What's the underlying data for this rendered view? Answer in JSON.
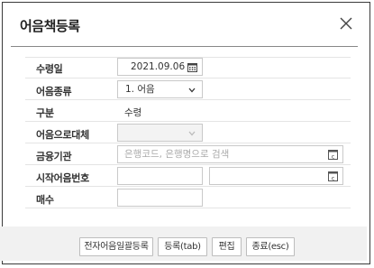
{
  "dialog": {
    "title": "어음책등록"
  },
  "form": {
    "receipt_date": {
      "label": "수령일",
      "value": "2021.09.06"
    },
    "bill_type": {
      "label": "어음종류",
      "value": "1. 어음"
    },
    "category": {
      "label": "구분",
      "value": "수령"
    },
    "bill_substitute": {
      "label": "어음으로대체",
      "value": ""
    },
    "bank": {
      "label": "금융기관",
      "placeholder": "은행코드, 은행명으로 검색"
    },
    "start_bill_number": {
      "label": "시작어음번호",
      "value_1": "",
      "value_2": ""
    },
    "count": {
      "label": "매수",
      "value": ""
    }
  },
  "buttons": {
    "batch_register": "전자어음일괄등록",
    "register": "등록(tab)",
    "edit": "편집",
    "close": "종료(esc)"
  }
}
